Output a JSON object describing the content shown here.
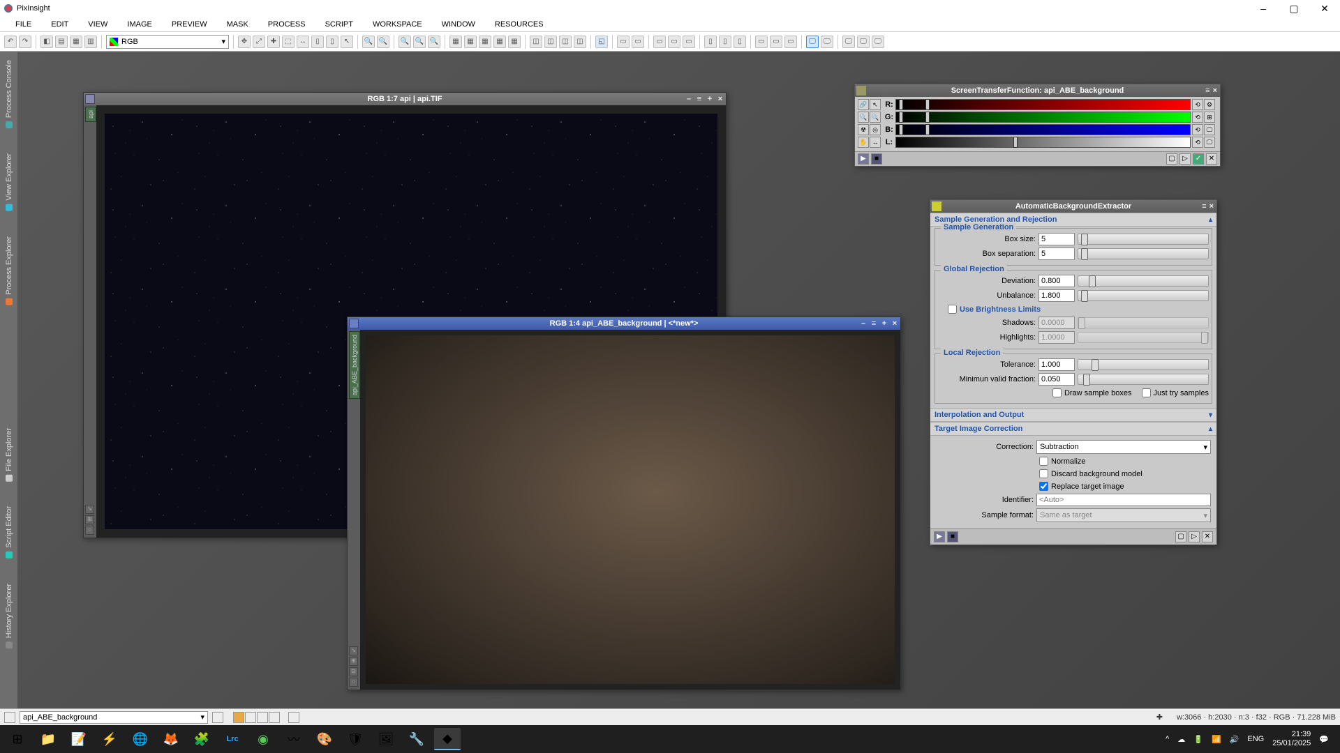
{
  "app": {
    "title": "PixInsight"
  },
  "menu": [
    "FILE",
    "EDIT",
    "VIEW",
    "IMAGE",
    "PREVIEW",
    "MASK",
    "PROCESS",
    "SCRIPT",
    "WORKSPACE",
    "WINDOW",
    "RESOURCES"
  ],
  "rgb_selector": "RGB",
  "left_tabs": [
    {
      "label": "Process Console",
      "color": "#4aa"
    },
    {
      "label": "View Explorer",
      "color": "#3bd"
    },
    {
      "label": "Process Explorer",
      "color": "#e73"
    },
    {
      "label": "File Explorer",
      "color": "#ccc"
    },
    {
      "label": "Script Editor",
      "color": "#2cb"
    },
    {
      "label": "History Explorer",
      "color": "#888"
    }
  ],
  "win1": {
    "title": "RGB 1:7 api | api.TIF",
    "side_label": "api"
  },
  "win2": {
    "title": "RGB 1:4 api_ABE_background | <*new*>",
    "side_label": "api_ABE_background"
  },
  "stf": {
    "title": "ScreenTransferFunction: api_ABE_background",
    "channels": [
      "R:",
      "G:",
      "B:",
      "L:"
    ]
  },
  "abe": {
    "title": "AutomaticBackgroundExtractor",
    "sect1": "Sample Generation and Rejection",
    "sub_sg": "Sample Generation",
    "box_size_lbl": "Box size:",
    "box_size": "5",
    "box_sep_lbl": "Box separation:",
    "box_sep": "5",
    "sub_gr": "Global Rejection",
    "dev_lbl": "Deviation:",
    "dev": "0.800",
    "unb_lbl": "Unbalance:",
    "unb": "1.800",
    "use_bl": "Use Brightness Limits",
    "shad_lbl": "Shadows:",
    "shad": "0.0000",
    "high_lbl": "Highlights:",
    "high": "1.0000",
    "sub_lr": "Local Rejection",
    "tol_lbl": "Tolerance:",
    "tol": "1.000",
    "mvf_lbl": "Minimun valid fraction:",
    "mvf": "0.050",
    "draw_sb": "Draw sample boxes",
    "just_try": "Just try samples",
    "sect2": "Interpolation and Output",
    "sect3": "Target Image Correction",
    "corr_lbl": "Correction:",
    "corr": "Subtraction",
    "norm": "Normalize",
    "disc": "Discard background model",
    "repl": "Replace target image",
    "ident_lbl": "Identifier:",
    "ident_ph": "<Auto>",
    "sfmt_lbl": "Sample format:",
    "sfmt": "Same as target"
  },
  "status": {
    "view": "api_ABE_background",
    "info": "w:3066 · h:2030 · n:3 · f32 · RGB · 71.228 MiB"
  },
  "tray": {
    "time": "21:39",
    "date": "25/01/2025"
  }
}
